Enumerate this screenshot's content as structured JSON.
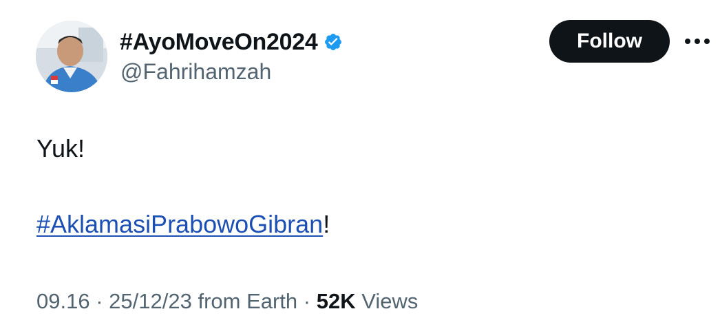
{
  "author": {
    "display_name": "#AyoMoveOn2024",
    "handle": "@Fahrihamzah",
    "verified": true,
    "verified_color": "#1d9bf0"
  },
  "actions": {
    "follow_label": "Follow",
    "more_label": "•••"
  },
  "tweet": {
    "text": "Yuk!",
    "hashtag": "#AklamasiPrabowoGibran",
    "hashtag_suffix": "!",
    "link_color": "#1c4fb3"
  },
  "meta": {
    "time": "09.16",
    "separator": "·",
    "date": "25/12/23",
    "source": "from Earth",
    "views_count": "52K",
    "views_label": "Views"
  }
}
